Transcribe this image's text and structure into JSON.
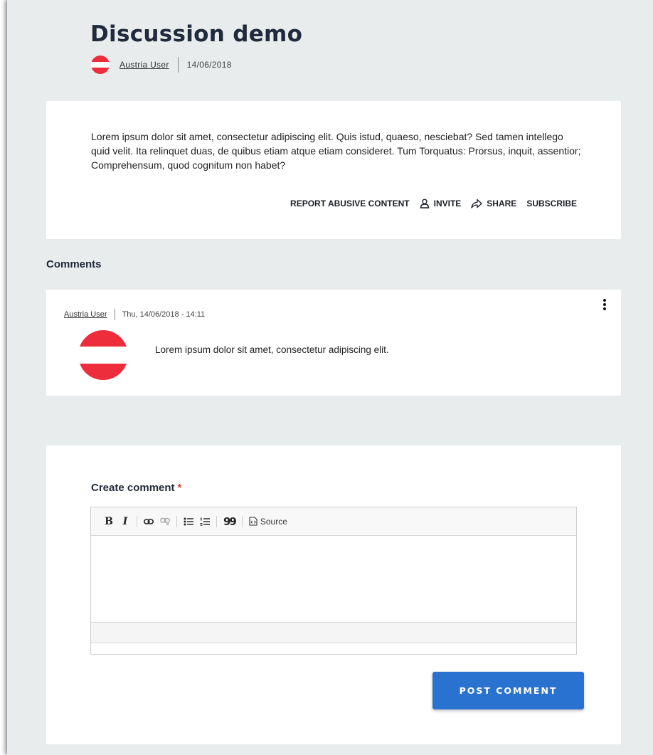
{
  "node": {
    "title": "Discussion demo",
    "author": "Austria User",
    "date": "14/06/2018",
    "body": "Lorem ipsum dolor sit amet, consectetur adipiscing elit. Quis istud, quaeso, nesciebat? Sed tamen intellego quid velit. Ita relinquet duas, de quibus etiam atque etiam consideret. Tum Torquatus: Prorsus, inquit, assentior; Comprehensum, quod cognitum non habet?",
    "actions": {
      "report": "REPORT ABUSIVE CONTENT",
      "invite": "INVITE",
      "share": "SHARE",
      "subscribe": "SUBSCRIBE"
    }
  },
  "comments": {
    "heading": "Comments",
    "items": [
      {
        "author": "Austria User",
        "date": "Thu, 14/06/2018 - 14:11",
        "text": "Lorem ipsum dolor sit amet, consectetur adipiscing elit."
      }
    ]
  },
  "form": {
    "label": "Create comment",
    "required_mark": "*",
    "toolbar": {
      "bold": "B",
      "italic": "I",
      "blockquote": "99",
      "source": "Source"
    },
    "submit": "POST COMMENT"
  },
  "colors": {
    "accent": "#2a72cf",
    "flag_red": "#ee2d3c",
    "required": "#e0362a"
  },
  "icons": [
    "user-avatar-flag-icon",
    "invite-person-icon",
    "share-arrow-icon",
    "kebab-menu-icon",
    "link-icon",
    "unlink-icon",
    "bulleted-list-icon",
    "numbered-list-icon",
    "blockquote-icon",
    "source-icon"
  ]
}
